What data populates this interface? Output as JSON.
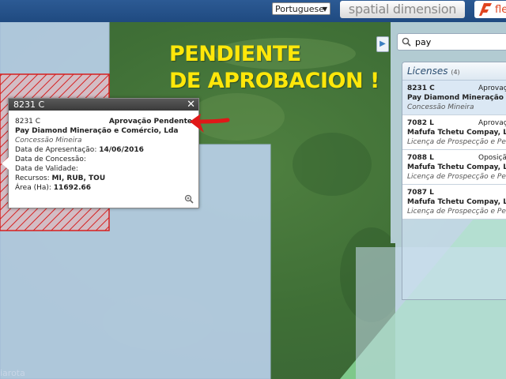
{
  "topbar": {
    "language_selected": "Portuguese",
    "brand_name": "spatial dimension",
    "flex_logo_text": "fle"
  },
  "map": {
    "attribution": "iarota",
    "annotation": {
      "line1": "PENDIENTE",
      "line2": "DE APROBACION !",
      "color": "#ffe70a"
    }
  },
  "popup": {
    "title": "8231 C",
    "close_symbol": "✕",
    "license_id": "8231 C",
    "status": "Aprovação Pendente",
    "company": "Pay Diamond Mineração e Comércio, Lda",
    "license_type": "Concessão Mineira",
    "fields": [
      {
        "label": "Data de Apresentação:",
        "value": "14/06/2016"
      },
      {
        "label": "Data de Concessão:",
        "value": ""
      },
      {
        "label": "Data de Validade:",
        "value": ""
      },
      {
        "label": "Recursos:",
        "value": "MI, RUB, TOU"
      },
      {
        "label": "Área (Ha):",
        "value": "11692.66"
      }
    ]
  },
  "search": {
    "value": "pay"
  },
  "licenses": {
    "title": "Licenses",
    "count": "(4)",
    "items": [
      {
        "id": "8231 C",
        "status": "Aprovação Pendente",
        "company": "Pay Diamond Mineração e Comércio, Lda",
        "type": "Concessão Mineira"
      },
      {
        "id": "7082 L",
        "status": "Aprovação",
        "company": "Mafufa Tchetu Compay, Limitada",
        "type": "Licença de Prospecção e Pesquisa"
      },
      {
        "id": "7088 L",
        "status": "Oposição",
        "company": "Mafufa Tchetu Compay, Limitada",
        "type": "Licença de Prospecção e Pesquisa"
      },
      {
        "id": "7087 L",
        "status": "",
        "company": "Mafufa Tchetu Compay, Limitada",
        "type": "Licença de Prospecção e Pesquisa"
      }
    ]
  },
  "colors": {
    "topbar": "#1f4a80",
    "boundary_red": "#d62020",
    "arrow_red": "#e01818",
    "license_area_blue": "#b9cfe8",
    "license_area_green": "#8fe0a0"
  }
}
